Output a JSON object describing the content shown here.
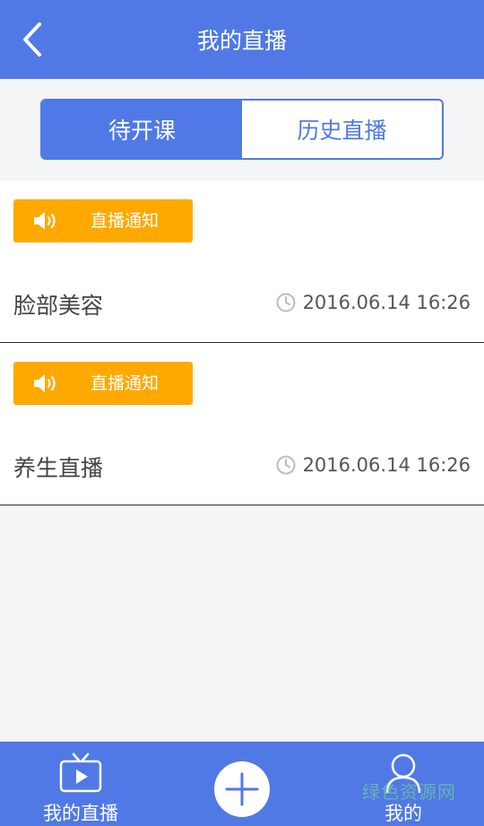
{
  "header": {
    "title": "我的直播"
  },
  "tabs": [
    {
      "label": "待开课",
      "active": true
    },
    {
      "label": "历史直播",
      "active": false
    }
  ],
  "items": [
    {
      "badge": "直播通知",
      "title": "脸部美容",
      "time": "2016.06.14 16:26"
    },
    {
      "badge": "直播通知",
      "title": "养生直播",
      "time": "2016.06.14 16:26"
    }
  ],
  "bottom_nav": {
    "live_label": "我的直播",
    "mine_label": "我的"
  },
  "watermark": "绿色资源网",
  "colors": {
    "primary": "#5079e6",
    "badge": "#ffa800"
  },
  "icons": [
    "back-icon",
    "speaker-icon",
    "clock-icon",
    "tv-icon",
    "plus-icon",
    "user-icon"
  ]
}
